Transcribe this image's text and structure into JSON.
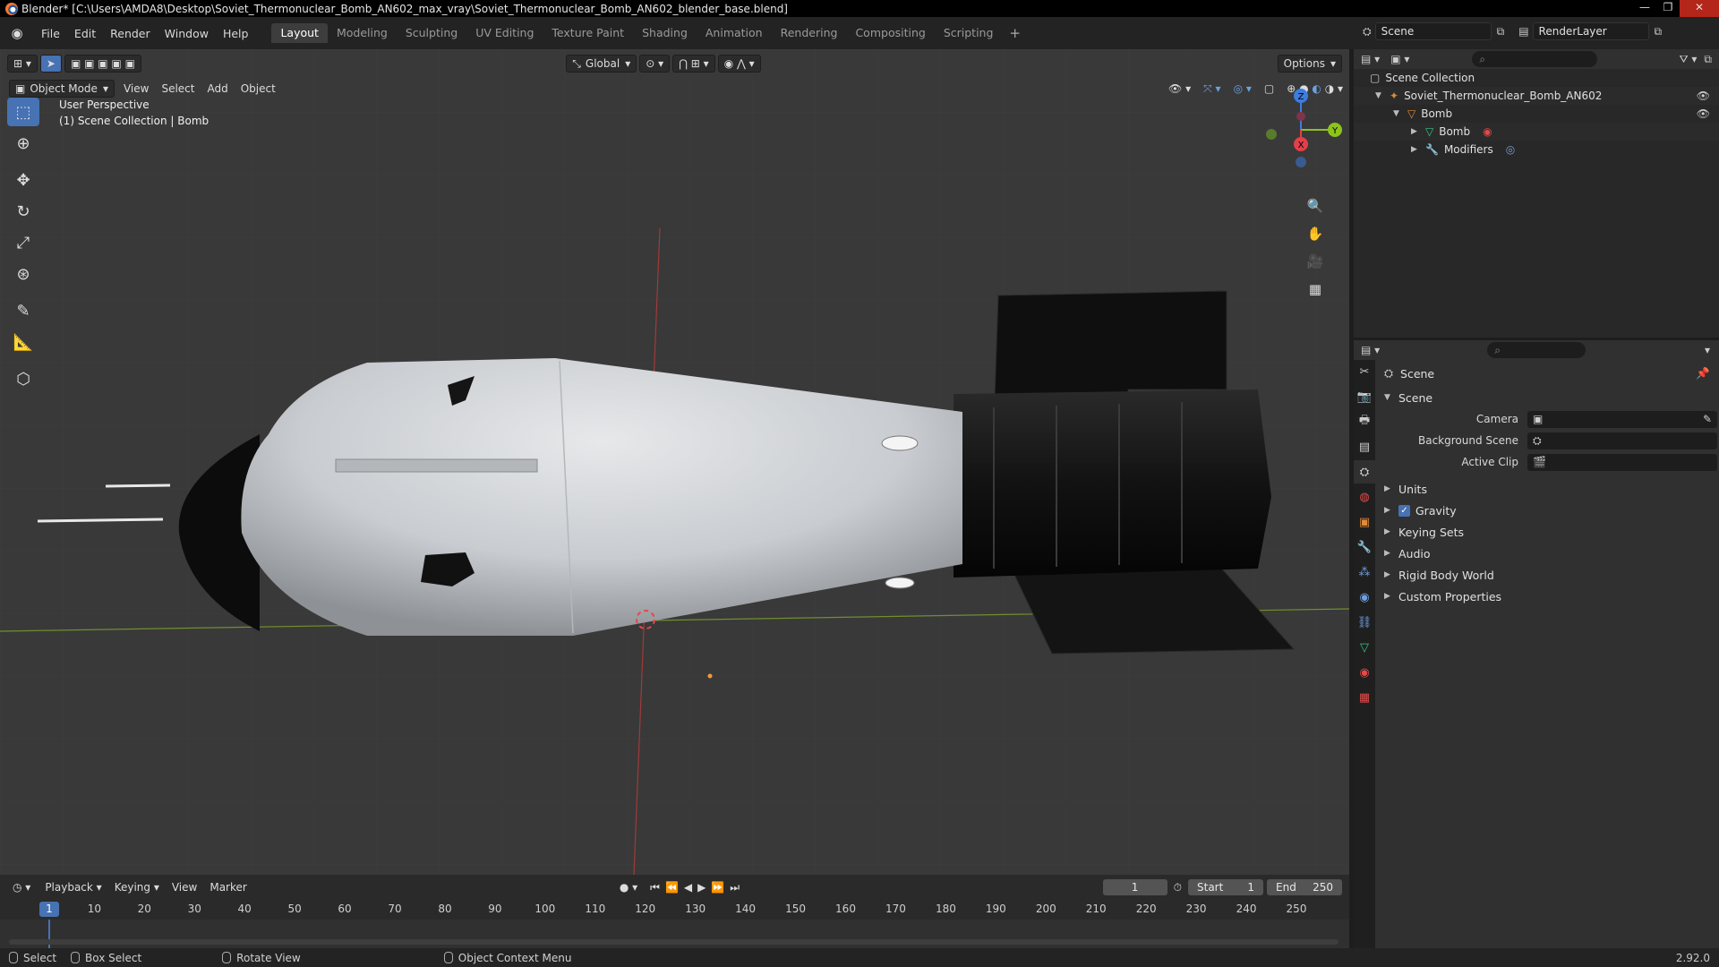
{
  "window": {
    "title": "Blender* [C:\\Users\\AMDA8\\Desktop\\Soviet_Thermonuclear_Bomb_AN602_max_vray\\Soviet_Thermonuclear_Bomb_AN602_blender_base.blend]"
  },
  "menu": {
    "items": [
      "File",
      "Edit",
      "Render",
      "Window",
      "Help"
    ]
  },
  "workspaces": {
    "tabs": [
      "Layout",
      "Modeling",
      "Sculpting",
      "UV Editing",
      "Texture Paint",
      "Shading",
      "Animation",
      "Rendering",
      "Compositing",
      "Scripting"
    ],
    "add": "+"
  },
  "scene_selector": {
    "scene": "Scene",
    "view_layer": "RenderLayer"
  },
  "viewport": {
    "transform_orientation": "Global",
    "options_label": "Options",
    "mode": "Object Mode",
    "menus": [
      "View",
      "Select",
      "Add",
      "Object"
    ],
    "info_line1": "User Perspective",
    "info_line2": "(1) Scene Collection | Bomb",
    "gizmo_axes": {
      "x": "X",
      "y": "Y",
      "z": "Z"
    }
  },
  "timeline": {
    "menus": [
      "Playback",
      "Keying",
      "View",
      "Marker"
    ],
    "current_frame": "1",
    "start_label": "Start",
    "start": "1",
    "end_label": "End",
    "end": "250",
    "ticks": [
      "10",
      "20",
      "30",
      "40",
      "50",
      "60",
      "70",
      "80",
      "90",
      "100",
      "110",
      "120",
      "130",
      "140",
      "150",
      "160",
      "170",
      "180",
      "190",
      "200",
      "210",
      "220",
      "230",
      "240",
      "250"
    ]
  },
  "statusbar": {
    "select": "Select",
    "box_select": "Box Select",
    "rotate_view": "Rotate View",
    "context_menu": "Object Context Menu",
    "version": "2.92.0"
  },
  "outliner": {
    "root": "Scene Collection",
    "collection": "Soviet_Thermonuclear_Bomb_AN602",
    "object": "Bomb",
    "mesh": "Bomb",
    "modifiers": "Modifiers"
  },
  "properties": {
    "breadcrumb": "Scene",
    "panel_title": "Scene",
    "fields": [
      {
        "label": "Camera",
        "value": ""
      },
      {
        "label": "Background Scene",
        "value": ""
      },
      {
        "label": "Active Clip",
        "value": ""
      }
    ],
    "subpanels": [
      "Units",
      "Gravity",
      "Keying Sets",
      "Audio",
      "Rigid Body World",
      "Custom Properties"
    ]
  },
  "colors": {
    "accent": "#4772b3",
    "x_axis": "#e0404a",
    "y_axis": "#8cc41c",
    "z_axis": "#3d7ce0",
    "viewport_bg": "#393939"
  }
}
